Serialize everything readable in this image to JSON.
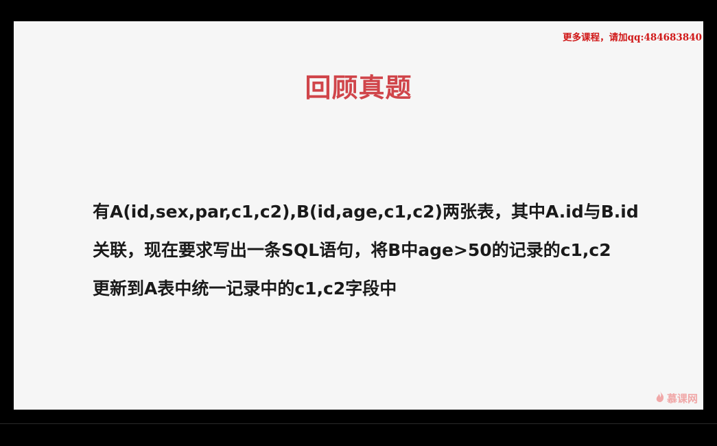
{
  "slide": {
    "corner_note": "更多课程，请加qq:484683840",
    "title": "回顾真题",
    "question_lines": [
      "有A(id,sex,par,c1,c2),B(id,age,c1,c2)两张表，其中A.id与B.id",
      "关联，现在要求写出一条SQL语句，将B中age>50的记录的c1,c2",
      "更新到A表中统一记录中的c1,c2字段中"
    ],
    "watermark": "慕课网"
  },
  "icons": {
    "watermark_icon": "flame-icon"
  },
  "colors": {
    "title": "#d0454a",
    "corner_note": "#d01818",
    "body_text": "#1a1a1a",
    "slide_bg": "#f6f6f6",
    "watermark": "#f0a8a8"
  }
}
